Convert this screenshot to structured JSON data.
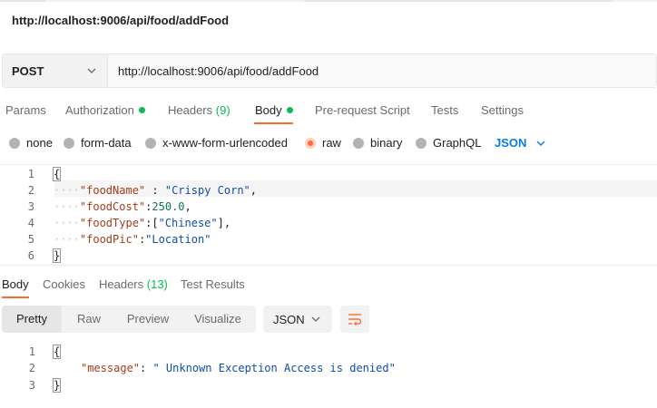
{
  "request_title": "http://localhost:9006/api/food/addFood",
  "method": "POST",
  "url": "http://localhost:9006/api/food/addFood",
  "request_tabs": {
    "params": "Params",
    "authorization": "Authorization",
    "headers": "Headers",
    "headers_count": "(9)",
    "body": "Body",
    "pre_request": "Pre-request Script",
    "tests": "Tests",
    "settings": "Settings"
  },
  "body_modes": {
    "none": "none",
    "form_data": "form-data",
    "urlencoded": "x-www-form-urlencoded",
    "raw": "raw",
    "binary": "binary",
    "graphql": "GraphQL",
    "selected": "raw",
    "raw_language": "JSON"
  },
  "request_body": {
    "line_numbers": [
      "1",
      "2",
      "3",
      "4",
      "5",
      "6"
    ],
    "open_brace": "{",
    "close_brace": "}",
    "fields": [
      {
        "key": "\"foodName\"",
        "sep": " : ",
        "value": "\"Crispy Corn\"",
        "trail": ","
      },
      {
        "key": "\"foodCost\"",
        "sep": ":",
        "value": "250.0",
        "trail": ","
      },
      {
        "key": "\"foodType\"",
        "sep": ":[",
        "value": "\"Chinese\"",
        "trail": "],"
      },
      {
        "key": "\"foodPic\"",
        "sep": ":",
        "value": "\"Location\"",
        "trail": ""
      }
    ]
  },
  "response_tabs": {
    "body": "Body",
    "cookies": "Cookies",
    "headers": "Headers",
    "headers_count": "(13)",
    "test_results": "Test Results"
  },
  "response_view": {
    "pretty": "Pretty",
    "raw": "Raw",
    "preview": "Preview",
    "visualize": "Visualize",
    "format": "JSON",
    "wrap_icon": "wrap-lines-icon"
  },
  "response_body": {
    "line_numbers": [
      "1",
      "2",
      "3"
    ],
    "open_brace": "{",
    "close_brace": "}",
    "key": "\"message\"",
    "sep": ": ",
    "value": "\" Unknown Exception Access is denied\""
  },
  "colors": {
    "accent": "#ff6c37",
    "active_dot": "#0cbb52",
    "link_blue": "#097bed"
  }
}
